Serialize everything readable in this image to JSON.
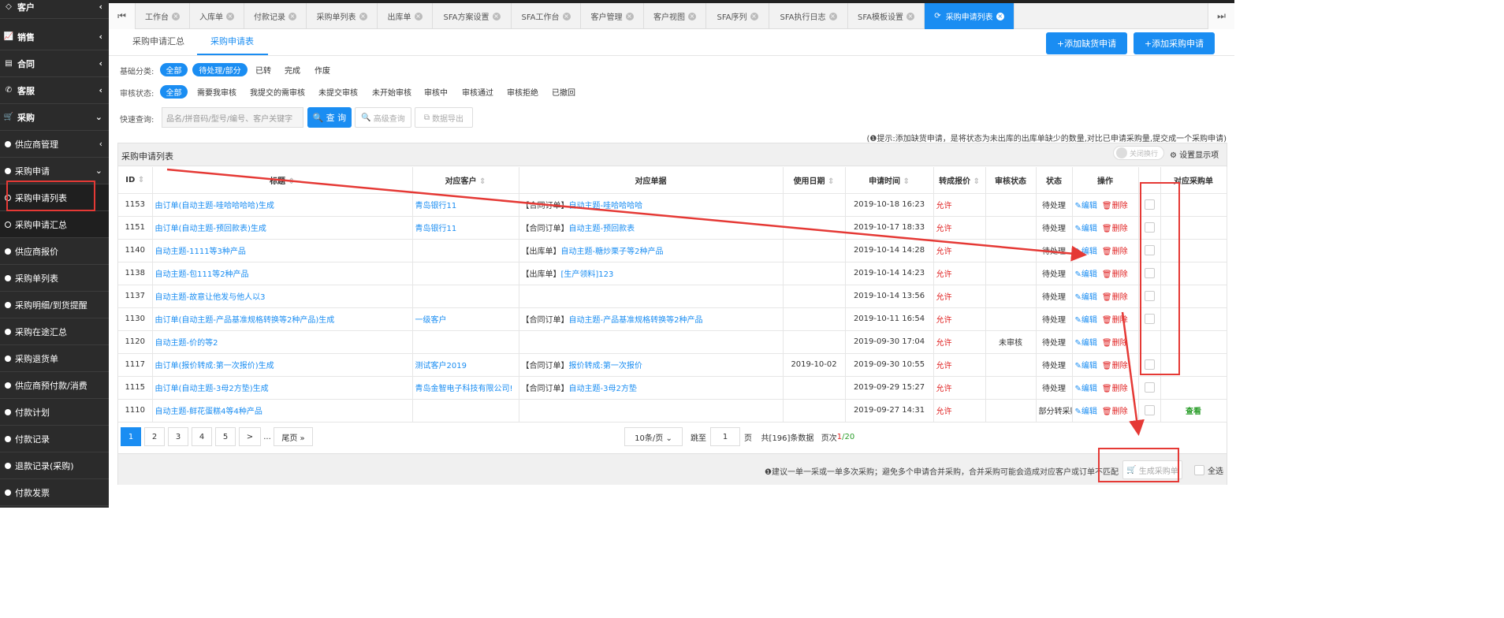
{
  "sidebar": {
    "items": [
      {
        "label": "客户",
        "icon": "diamond-icon"
      },
      {
        "label": "销售",
        "icon": "chart-icon"
      },
      {
        "label": "合同",
        "icon": "contract-icon"
      },
      {
        "label": "客服",
        "icon": "phone-icon"
      },
      {
        "label": "采购",
        "icon": "cart-icon"
      }
    ],
    "sub": [
      "供应商管理",
      "采购申请",
      "采购申请列表",
      "采购申请汇总",
      "供应商报价",
      "采购单列表",
      "采购明细/到货提醒",
      "采购在途汇总",
      "采购退货单",
      "供应商预付款/消费",
      "付款计划",
      "付款记录",
      "退款记录(采购)",
      "付款发票"
    ]
  },
  "tabs": [
    "工作台",
    "入库单",
    "付款记录",
    "采购单列表",
    "出库单",
    "SFA方案设置",
    "SFA工作台",
    "客户管理",
    "客户视图",
    "SFA序列",
    "SFA执行日志",
    "SFA模板设置",
    "采购申请列表"
  ],
  "subtabs": [
    "采购申请汇总",
    "采购申请表"
  ],
  "actions": {
    "add_shortage": "+添加缺货申请",
    "add_purchase": "+添加采购申请"
  },
  "filters": {
    "basic_label": "基础分类:",
    "basic": [
      "全部",
      "待处理/部分",
      "已转",
      "完成",
      "作废"
    ],
    "audit_label": "审核状态:",
    "audit": [
      "全部",
      "需要我审核",
      "我提交的需审核",
      "未提交审核",
      "未开始审核",
      "审核中",
      "审核通过",
      "审核拒绝",
      "已撤回"
    ],
    "quick_label": "快速查询:",
    "search_placeholder": "品名/拼音码/型号/编号、客户关键字",
    "search_btn": "查 询",
    "advanced_btn": "高级查询",
    "export_btn": "数据导出"
  },
  "hint": "(❶提示:添加缺货申请，是将状态为未出库的出库单缺少的数量,对比已申请采购量,提交成一个采购申请)",
  "panel": {
    "title": "采购申请列表",
    "toggle": "关闭换行",
    "settings": "设置显示项"
  },
  "table": {
    "headers": [
      "ID",
      "标题",
      "对应客户",
      "对应单据",
      "使用日期",
      "申请时间",
      "转成报价",
      "审核状态",
      "状态",
      "操作",
      "",
      "对应采购单"
    ],
    "edit": "编辑",
    "delete": "删除",
    "rows": [
      {
        "id": "1153",
        "title": "由订单(自动主题-哇哈哈哈哈)生成",
        "customer": "青岛银行11",
        "doc_type": "【合同订单】",
        "doc": "自动主题-哇哈哈哈哈",
        "use_date": "",
        "time": "2019-10-18 16:23",
        "quote": "允许",
        "audit": "",
        "status": "待处理",
        "po": "",
        "checkbox": true
      },
      {
        "id": "1151",
        "title": "由订单(自动主题-预回款表)生成",
        "customer": "青岛银行11",
        "doc_type": "【合同订单】",
        "doc": "自动主题-预回款表",
        "use_date": "",
        "time": "2019-10-17 18:33",
        "quote": "允许",
        "audit": "",
        "status": "待处理",
        "po": "",
        "checkbox": true
      },
      {
        "id": "1140",
        "title": "自动主题-1111等3种产品",
        "customer": "",
        "doc_type": "【出库单】",
        "doc": "自动主题-糖炒栗子等2种产品",
        "use_date": "",
        "time": "2019-10-14 14:28",
        "quote": "允许",
        "audit": "",
        "status": "待处理",
        "po": "",
        "checkbox": true
      },
      {
        "id": "1138",
        "title": "自动主题-包111等2种产品",
        "customer": "",
        "doc_type": "【出库单】",
        "doc": "[生产领料]123",
        "use_date": "",
        "time": "2019-10-14 14:23",
        "quote": "允许",
        "audit": "",
        "status": "待处理",
        "po": "",
        "checkbox": true
      },
      {
        "id": "1137",
        "title": "自动主题-故意让他发与他人以3",
        "customer": "",
        "doc_type": "",
        "doc": "",
        "use_date": "",
        "time": "2019-10-14 13:56",
        "quote": "允许",
        "audit": "",
        "status": "待处理",
        "po": "",
        "checkbox": true
      },
      {
        "id": "1130",
        "title": "由订单(自动主题-产品基准规格转换等2种产品)生成",
        "customer": "一级客户",
        "doc_type": "【合同订单】",
        "doc": "自动主题-产品基准规格转换等2种产品",
        "use_date": "",
        "time": "2019-10-11 16:54",
        "quote": "允许",
        "audit": "",
        "status": "待处理",
        "po": "",
        "checkbox": true
      },
      {
        "id": "1120",
        "title": "自动主题-价的等2",
        "customer": "",
        "doc_type": "",
        "doc": "",
        "use_date": "",
        "time": "2019-09-30 17:04",
        "quote": "允许",
        "audit": "未审核",
        "status": "待处理",
        "po": "",
        "checkbox": false
      },
      {
        "id": "1117",
        "title": "由订单(报价转成:第一次报价)生成",
        "customer": "测试客户2019",
        "doc_type": "【合同订单】",
        "doc": "报价转成:第一次报价",
        "use_date": "2019-10-02",
        "time": "2019-09-30 10:55",
        "quote": "允许",
        "audit": "",
        "status": "待处理",
        "po": "",
        "checkbox": true
      },
      {
        "id": "1115",
        "title": "由订单(自动主题-3母2方垫)生成",
        "customer": "青岛金智电子科技有限公司!",
        "doc_type": "【合同订单】",
        "doc": "自动主题-3母2方垫",
        "use_date": "",
        "time": "2019-09-29 15:27",
        "quote": "允许",
        "audit": "",
        "status": "待处理",
        "po": "",
        "checkbox": true
      },
      {
        "id": "1110",
        "title": "自动主题-鲜花蛋糕4等4种产品",
        "customer": "",
        "doc_type": "",
        "doc": "",
        "use_date": "",
        "time": "2019-09-27 14:31",
        "quote": "允许",
        "audit": "",
        "status": "部分转采购",
        "po": "查看",
        "checkbox": true
      }
    ]
  },
  "pager": {
    "pages": [
      "1",
      "2",
      "3",
      "4",
      "5",
      ">",
      "..."
    ],
    "last": "尾页 »",
    "per_page": "10条/页 ⌄",
    "jump_label": "跳至",
    "jump_value": "1",
    "page_unit": "页",
    "total": "共[196]条数据",
    "page_info_label": "页次",
    "page_current": "1",
    "page_total": "/20"
  },
  "footer": {
    "note": "❶建议一单一采或一单多次采购；避免多个申请合并采购，合并采购可能会造成对应客户或订单不匹配",
    "generate": "生成采购单",
    "select_all": "全选"
  },
  "colors": {
    "accent": "#1a8df2",
    "annotation": "#e53935",
    "sidebar": "#2b2b2b"
  }
}
